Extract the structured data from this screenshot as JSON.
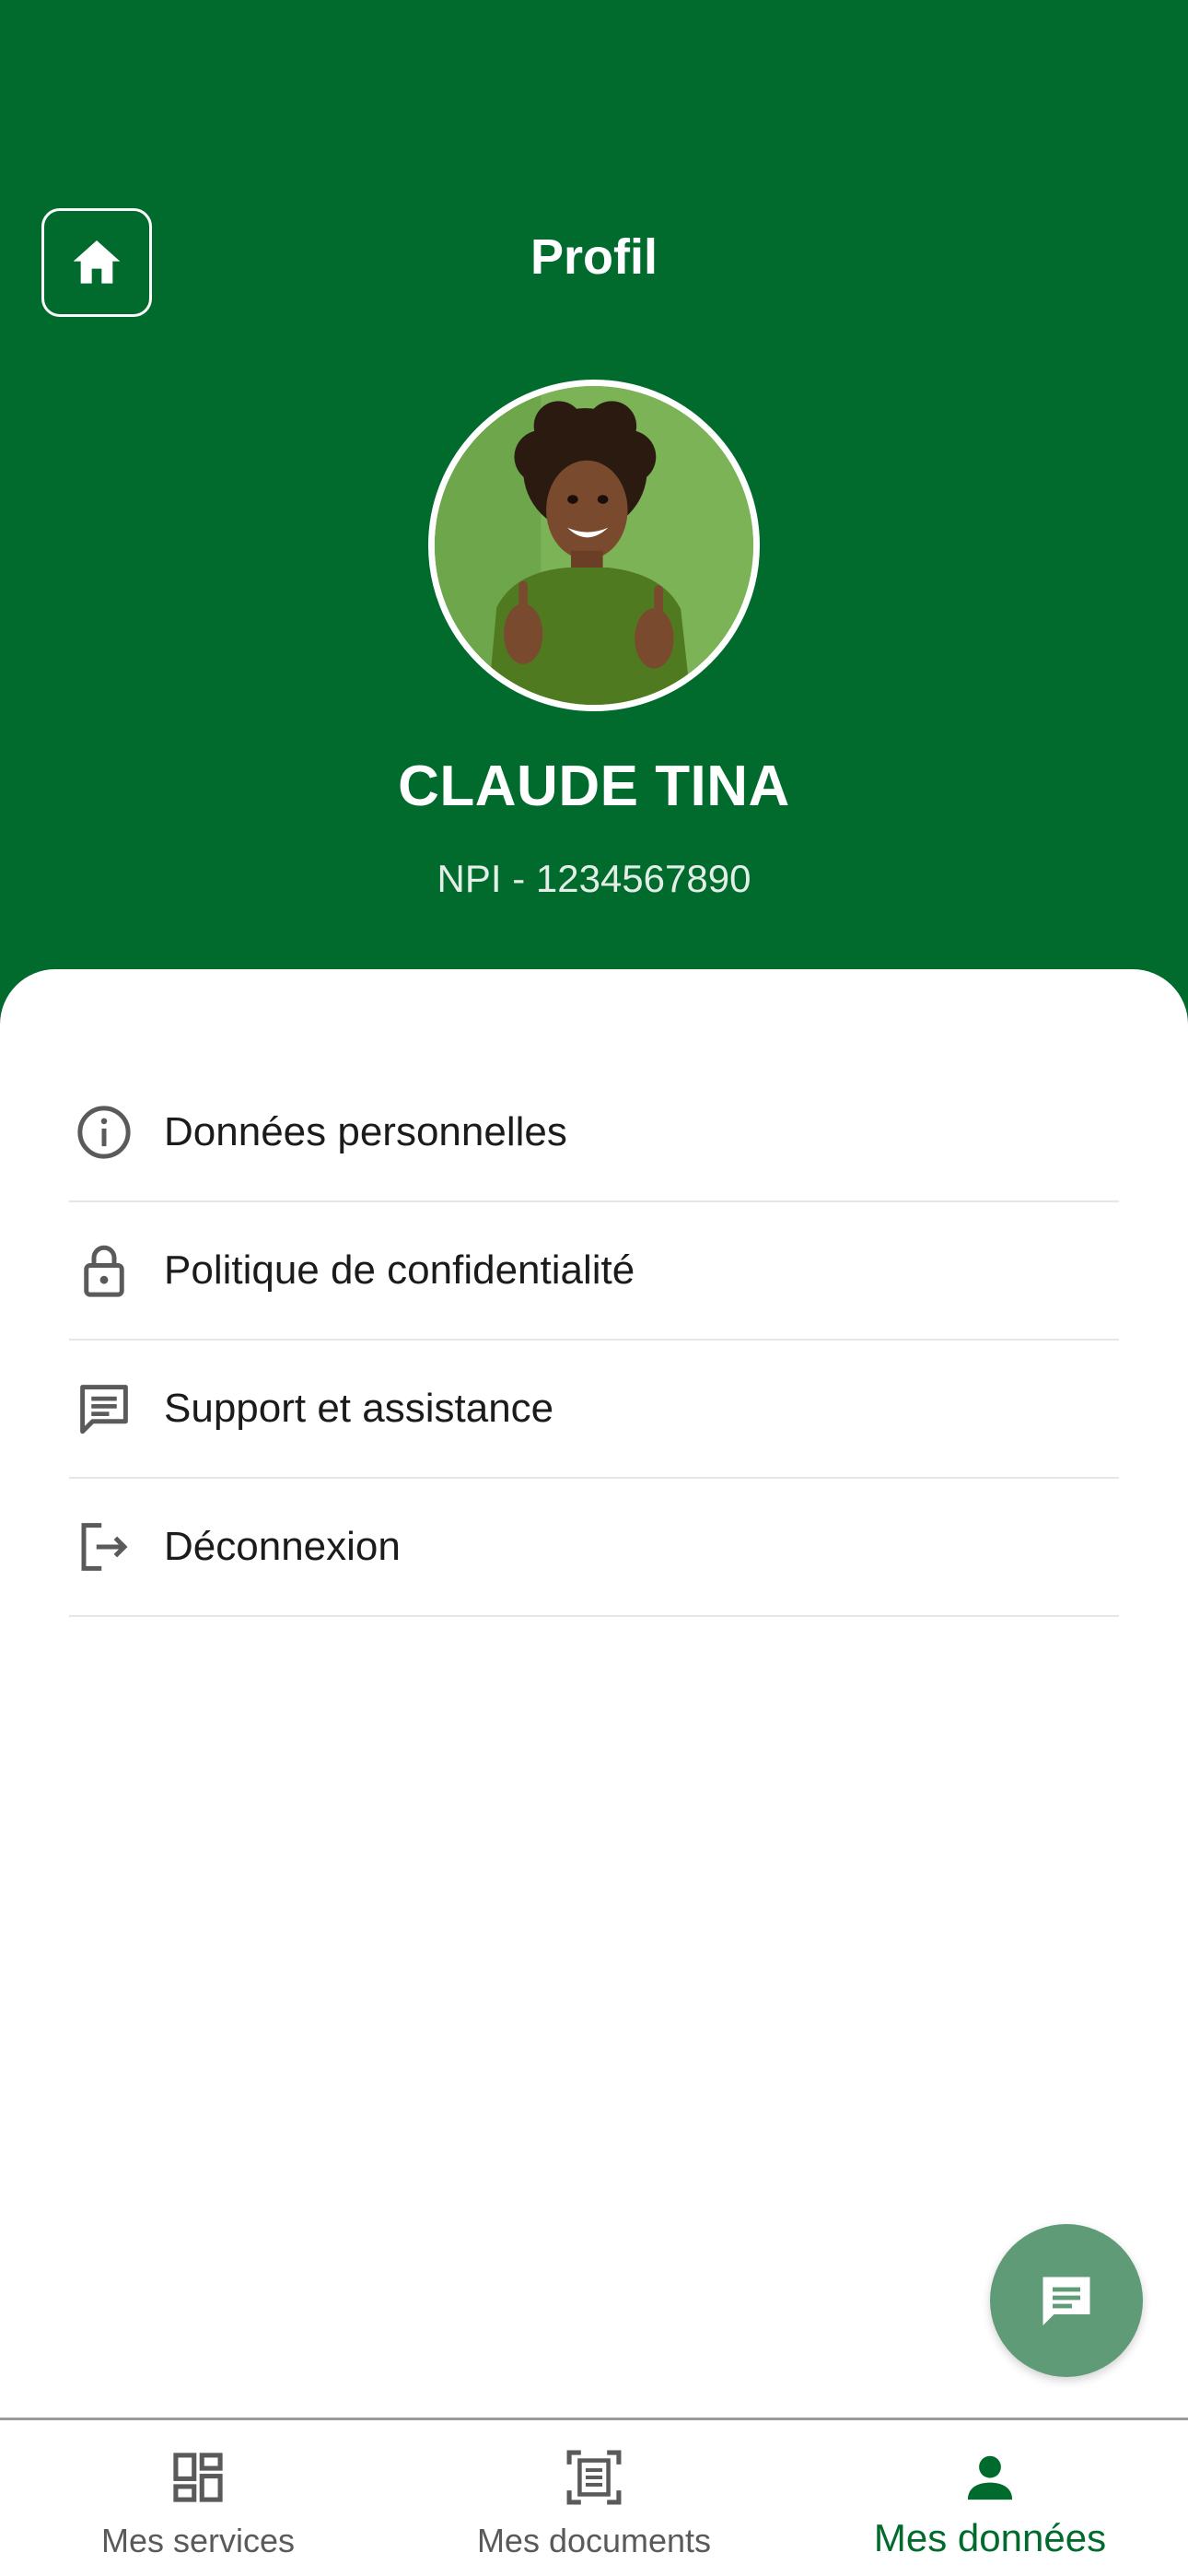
{
  "header": {
    "title": "Profil",
    "home_icon": "home-icon",
    "background_color": "#006b2d"
  },
  "profile": {
    "name": "CLAUDE TINA",
    "npi": "NPI - 1234567890"
  },
  "menu": {
    "items": [
      {
        "label": "Données personnelles",
        "icon": "info-icon"
      },
      {
        "label": "Politique de confidentialité",
        "icon": "lock-icon"
      },
      {
        "label": "Support et assistance",
        "icon": "message-icon"
      },
      {
        "label": "Déconnexion",
        "icon": "logout-icon"
      }
    ]
  },
  "fab": {
    "icon": "chat-icon",
    "color": "#5e9b76"
  },
  "bottom_nav": {
    "items": [
      {
        "label": "Mes services",
        "icon": "dashboard-icon",
        "active": false
      },
      {
        "label": "Mes documents",
        "icon": "document-scan-icon",
        "active": false
      },
      {
        "label": "Mes données",
        "icon": "person-icon",
        "active": true
      }
    ],
    "active_color": "#006b2d"
  }
}
